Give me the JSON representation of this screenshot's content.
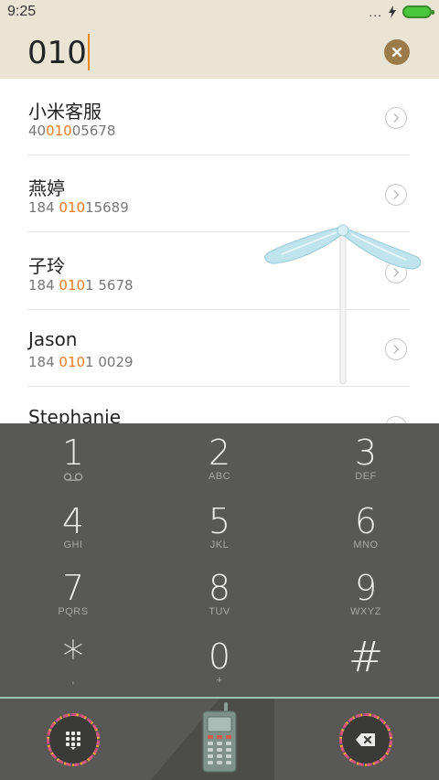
{
  "status_bar": {
    "time": "9:25",
    "dots": "...",
    "icons": [
      "signal-dots-icon",
      "charging-bolt-icon",
      "battery-icon"
    ],
    "battery_color": "#48c83a"
  },
  "search": {
    "query": "010",
    "clear_icon": "clear-icon"
  },
  "contacts": [
    {
      "name": "小米客服",
      "number_parts": [
        "40",
        "010",
        "05678"
      ]
    },
    {
      "name": "燕婷",
      "number_parts": [
        "184 ",
        "010",
        "15689"
      ]
    },
    {
      "name": "子玲",
      "number_parts": [
        "184 ",
        "010",
        "1 5678"
      ]
    },
    {
      "name": "Jason",
      "number_parts": [
        "184 ",
        "010",
        "1 0029"
      ]
    },
    {
      "name": "Stephanie",
      "number_parts": [
        "",
        "",
        ""
      ]
    }
  ],
  "dialpad": {
    "keys": [
      {
        "digit": "1",
        "letters": "",
        "icon": "voicemail-icon"
      },
      {
        "digit": "2",
        "letters": "ABC"
      },
      {
        "digit": "3",
        "letters": "DEF"
      },
      {
        "digit": "4",
        "letters": "GHI"
      },
      {
        "digit": "5",
        "letters": "JKL"
      },
      {
        "digit": "6",
        "letters": "MNO"
      },
      {
        "digit": "7",
        "letters": "PQRS"
      },
      {
        "digit": "8",
        "letters": "TUV"
      },
      {
        "digit": "9",
        "letters": "WXYZ"
      },
      {
        "digit": "*",
        "letters": ","
      },
      {
        "digit": "0",
        "letters": "+"
      },
      {
        "digit": "#",
        "letters": ""
      }
    ]
  },
  "bottom_bar": {
    "left_icon": "dialpad-grid-icon",
    "center_icon": "phone-handset-icon",
    "right_icon": "backspace-icon"
  },
  "colors": {
    "header_bg": "#e9e4d4",
    "highlight": "#f07a1e",
    "dialpad_bg": "#585856",
    "clear_button": "#9c7b4b",
    "accent_line": "#96c4b4"
  }
}
